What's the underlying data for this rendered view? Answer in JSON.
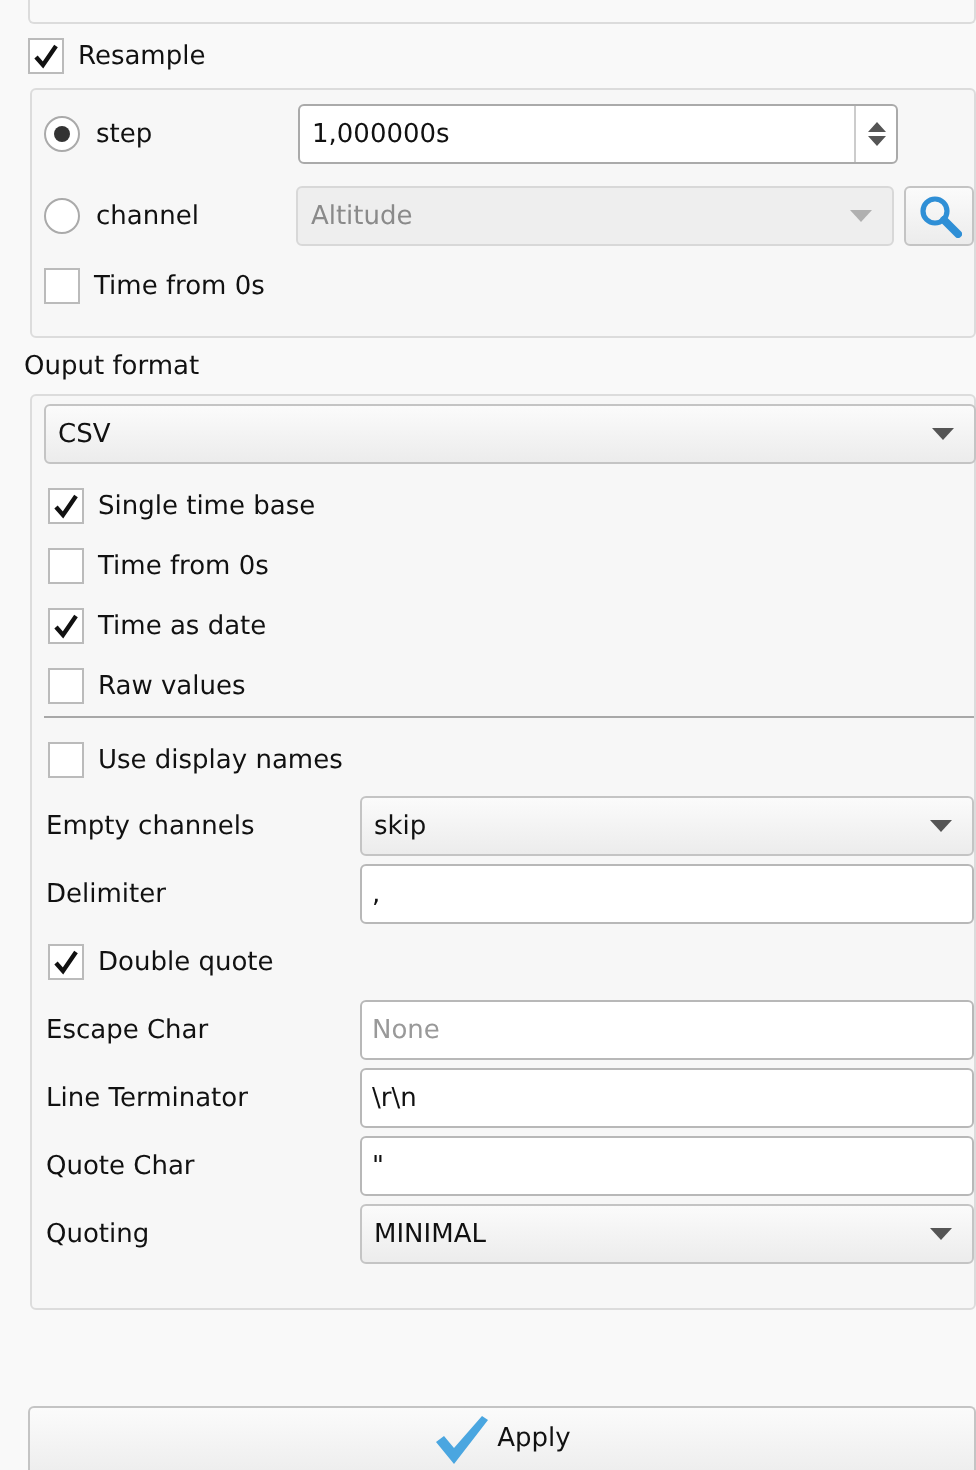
{
  "resample": {
    "label": "Resample",
    "checked": true,
    "modes": [
      {
        "kind": "spin",
        "label": "step",
        "selected": true,
        "value": "1,000000s"
      },
      {
        "kind": "combo",
        "label": "channel",
        "selected": false,
        "value": "Altitude",
        "disabled": true
      }
    ],
    "time_from_0s": {
      "label": "Time from 0s",
      "checked": false
    }
  },
  "output_format": {
    "title": "Ouput format",
    "format": "CSV",
    "options": [
      {
        "label": "Single time base",
        "checked": true
      },
      {
        "label": "Time from 0s",
        "checked": false
      },
      {
        "label": "Time as date",
        "checked": true
      },
      {
        "label": "Raw values",
        "checked": false
      }
    ],
    "use_display_names": {
      "label": "Use display names",
      "checked": false
    },
    "fields": [
      {
        "kind": "combo",
        "label": "Empty channels",
        "value": "skip"
      },
      {
        "kind": "text",
        "label": "Delimiter",
        "value": ","
      },
      {
        "kind": "check",
        "label": "Double quote",
        "checked": true
      },
      {
        "kind": "text",
        "label": "Escape Char",
        "placeholder": "None"
      },
      {
        "kind": "text",
        "label": "Line Terminator",
        "value": "\\r\\n"
      },
      {
        "kind": "text",
        "label": "Quote Char",
        "value": "\""
      },
      {
        "kind": "combo",
        "label": "Quoting",
        "value": "MINIMAL"
      }
    ]
  },
  "apply_button": {
    "label": "Apply"
  }
}
